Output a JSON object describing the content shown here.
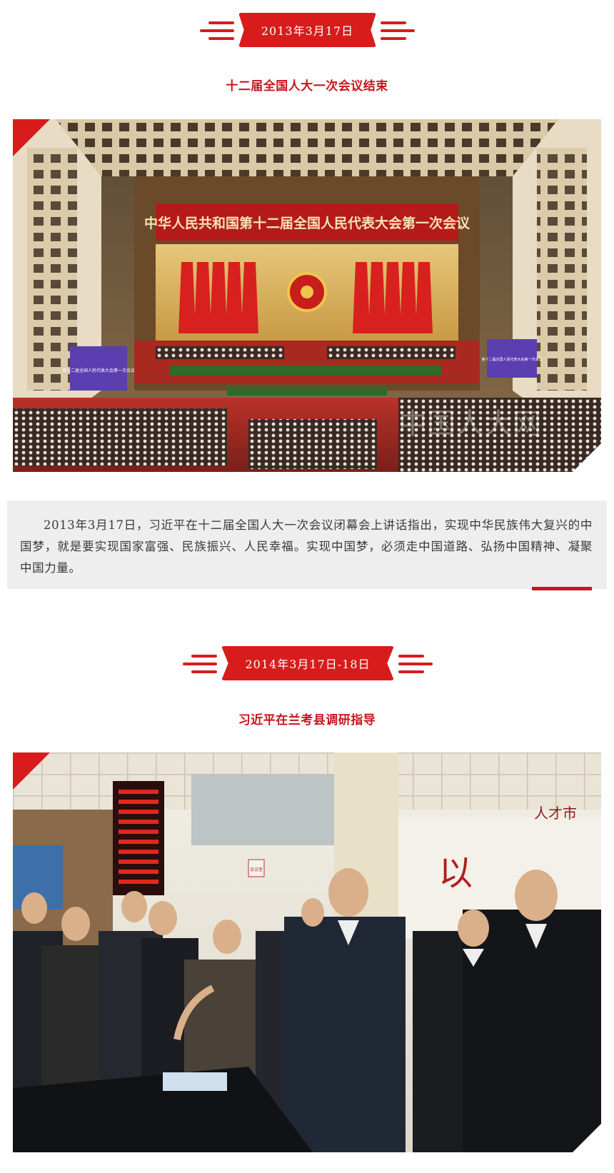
{
  "events": [
    {
      "date": "2013年3月17日",
      "title": "十二届全国人大一次会议结束",
      "photo": {
        "banner_text": "中华人民共和国第十二届全国人民代表大会第一次会议",
        "watermark": "中国人大网",
        "screen_text_left": "第十二届全国人民代表大会第一次会议",
        "screen_text_right": "第十二届全国人民代表大会第一次会议"
      },
      "caption": "2013年3月17日，习近平在十二届全国人大一次会议闭幕会上讲话指出，实现中华民族伟大复兴的中国梦，就是要实现国家富强、民族振兴、人民幸福。实现中国梦，必须走中国道路、弘扬中国精神、凝聚中国力量。"
    },
    {
      "date": "2014年3月17日-18日",
      "title": "习近平在兰考县调研指导",
      "photo": {
        "wall_sign_right": "以",
        "wall_sign_small": "人才市",
        "side_sign": "会议室"
      }
    }
  ],
  "colors": {
    "accent": "#d81c1c",
    "title_red": "#c8161d",
    "caption_bg": "#eeeeee"
  }
}
